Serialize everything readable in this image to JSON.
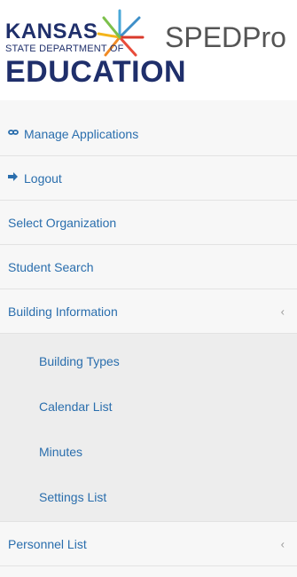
{
  "header": {
    "logo": {
      "line1": "KANSAS",
      "line2": "STATE DEPARTMENT OF",
      "line3": "EDUCATION"
    },
    "app_title": "SPEDPro"
  },
  "menu": {
    "items": [
      {
        "label": "Manage Applications",
        "icon": "link-icon"
      },
      {
        "label": "Logout",
        "icon": "sign-out-icon"
      },
      {
        "label": "Select Organization"
      },
      {
        "label": "Student Search"
      },
      {
        "label": "Building Information",
        "chevron": "‹"
      }
    ],
    "building_submenu": [
      {
        "label": "Building Types"
      },
      {
        "label": "Calendar List"
      },
      {
        "label": "Minutes"
      },
      {
        "label": "Settings List"
      }
    ],
    "after": [
      {
        "label": "Personnel List",
        "chevron": "‹"
      }
    ]
  },
  "colors": {
    "link": "#2a6ead",
    "logo_blue": "#1f2f6b",
    "menu_bg": "#f7f7f7",
    "submenu_bg": "#ededed"
  }
}
